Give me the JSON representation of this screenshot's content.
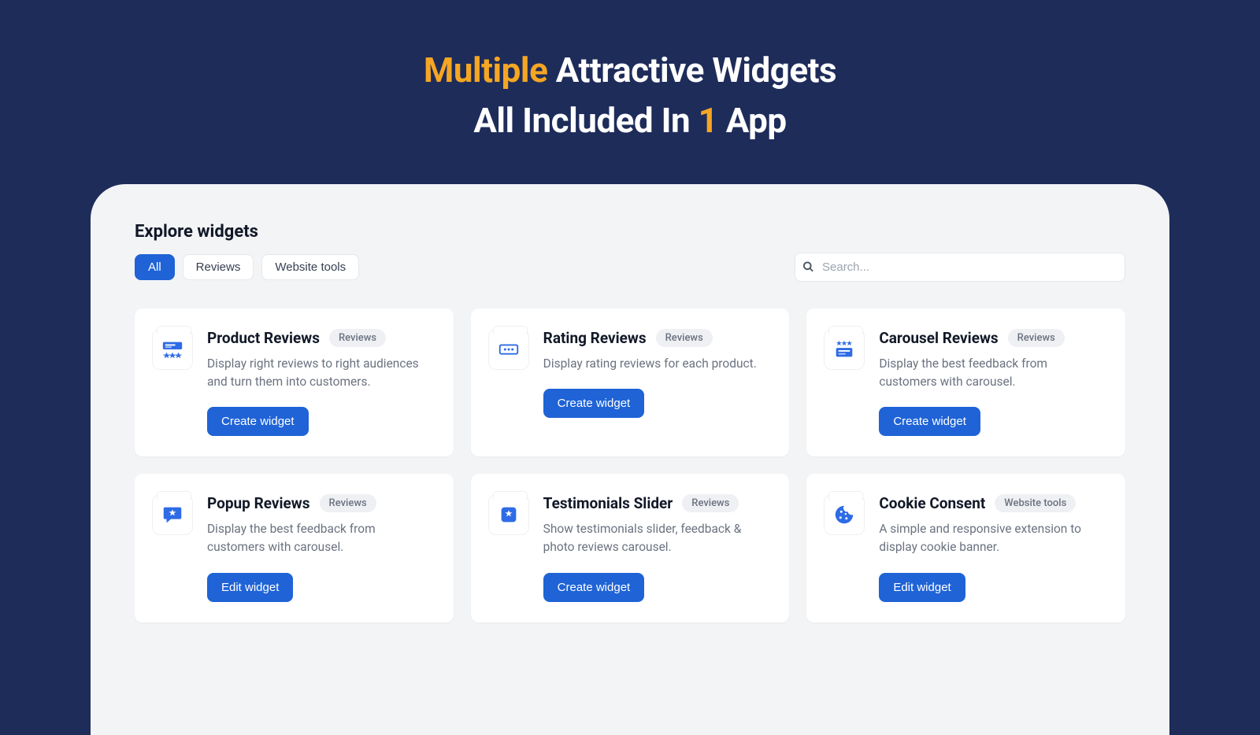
{
  "hero": {
    "line1_accent": "Multiple",
    "line1_rest": " Attractive Widgets",
    "line2_pre": "All Included In ",
    "line2_accent": "1",
    "line2_post": " App"
  },
  "panel": {
    "title": "Explore widgets",
    "tabs": [
      "All",
      "Reviews",
      "Website tools"
    ],
    "search_placeholder": "Search..."
  },
  "cards": [
    {
      "title": "Product Reviews",
      "tag": "Reviews",
      "desc": "Display right reviews to right audiences and turn them into customers.",
      "button": "Create widget",
      "icon": "product-reviews"
    },
    {
      "title": "Rating Reviews",
      "tag": "Reviews",
      "desc": "Display rating reviews for each product.",
      "button": "Create widget",
      "icon": "rating-reviews"
    },
    {
      "title": "Carousel Reviews",
      "tag": "Reviews",
      "desc": "Display the best feedback from customers with carousel.",
      "button": "Create widget",
      "icon": "carousel-reviews"
    },
    {
      "title": "Popup Reviews",
      "tag": "Reviews",
      "desc": "Display the best feedback from customers with carousel.",
      "button": "Edit widget",
      "icon": "popup-reviews"
    },
    {
      "title": "Testimonials Slider",
      "tag": "Reviews",
      "desc": "Show testimonials slider, feedback & photo reviews carousel.",
      "button": "Create widget",
      "icon": "testimonials-slider"
    },
    {
      "title": "Cookie Consent",
      "tag": "Website tools",
      "desc": "A simple and responsive extension to display cookie banner.",
      "button": "Edit widget",
      "icon": "cookie-consent"
    }
  ]
}
